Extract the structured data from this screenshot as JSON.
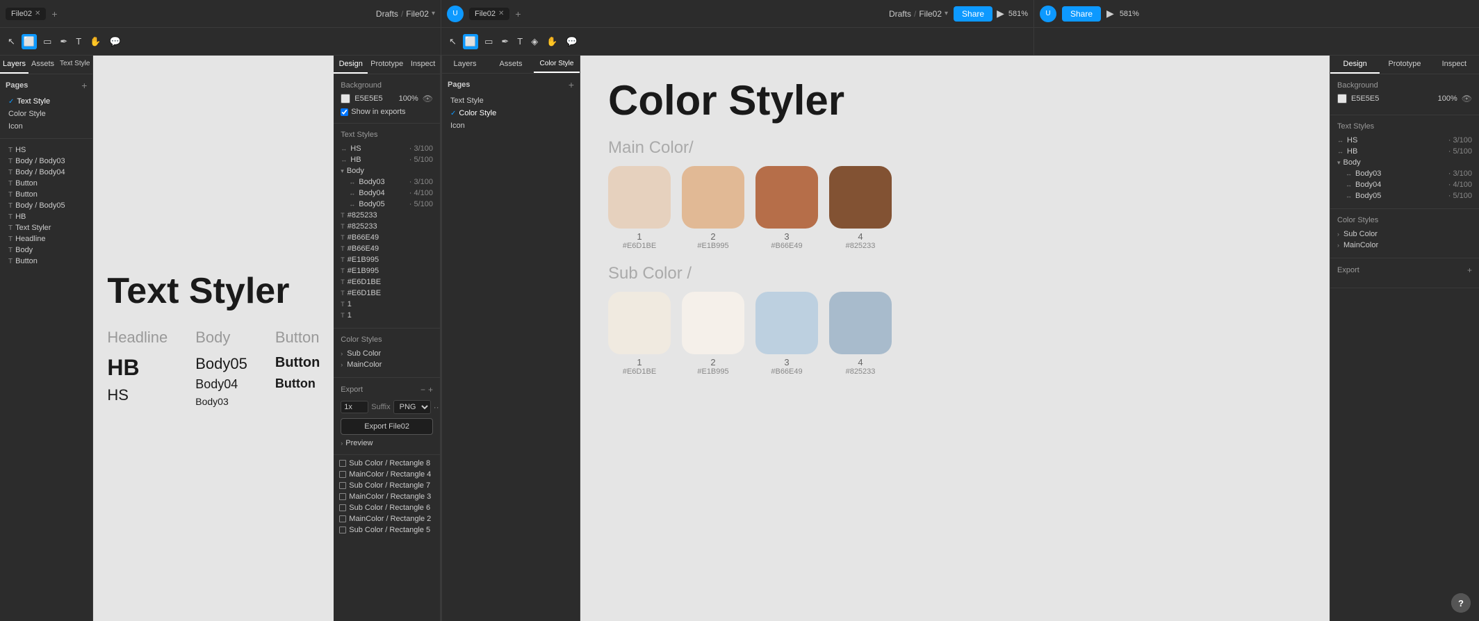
{
  "windows": {
    "left": {
      "title_bar": {
        "tab_label": "File02",
        "breadcrumb_drafts": "Drafts",
        "breadcrumb_sep": "/",
        "breadcrumb_file": "File02"
      },
      "toolbar": {},
      "left_panel": {
        "tabs": [
          "Layers",
          "Assets"
        ],
        "text_style_tab": "Text Style",
        "pages_label": "Pages",
        "pages": [
          {
            "label": "Text Style",
            "active": true
          },
          {
            "label": "Color Style",
            "active": false
          },
          {
            "label": "Icon",
            "active": false
          }
        ],
        "layers": [
          {
            "icon": "T",
            "label": "HS"
          },
          {
            "icon": "T",
            "label": "Body / Body03"
          },
          {
            "icon": "T",
            "label": "Body / Body04"
          },
          {
            "icon": "T",
            "label": "Button"
          },
          {
            "icon": "T",
            "label": "Button"
          },
          {
            "icon": "T",
            "label": "Body / Body05"
          },
          {
            "icon": "T",
            "label": "HB"
          },
          {
            "icon": "T",
            "label": "Text Styler"
          },
          {
            "icon": "T",
            "label": "Headline"
          },
          {
            "icon": "T",
            "label": "Body"
          },
          {
            "icon": "T",
            "label": "Button"
          }
        ]
      },
      "canvas": {
        "title": "Text Styler",
        "columns": [
          "Headline",
          "Body",
          "Button"
        ],
        "rows": [
          {
            "col1": "HB",
            "col2": "Body05",
            "col3": "Button"
          },
          {
            "col1": "HS",
            "col2": "Body04",
            "col3": "Button"
          },
          {
            "col1": "",
            "col2": "Body03",
            "col3": ""
          }
        ]
      },
      "design_panel": {
        "tabs": [
          "Design",
          "Prototype",
          "Inspect"
        ],
        "background_label": "Background",
        "bg_color": "E5E5E5",
        "bg_opacity": "100%",
        "show_in_exports": "Show in exports",
        "text_styles_label": "Text Styles",
        "text_styles": [
          {
            "label": "HS",
            "value": "3/100"
          },
          {
            "label": "HB",
            "value": "5/100"
          },
          {
            "group": "Body",
            "children": [
              {
                "label": "Body03",
                "value": "3/100"
              },
              {
                "label": "Body04",
                "value": "4/100"
              },
              {
                "label": "Body05",
                "value": "5/100"
              }
            ]
          },
          {
            "label": "#825233",
            "value": ""
          },
          {
            "label": "#825233",
            "value": ""
          },
          {
            "label": "#B66E49",
            "value": ""
          },
          {
            "label": "#B66E49",
            "value": ""
          },
          {
            "label": "#E1B995",
            "value": ""
          },
          {
            "label": "#E1B995",
            "value": ""
          },
          {
            "label": "#E6D1BE",
            "value": ""
          },
          {
            "label": "#E6D1BE",
            "value": ""
          },
          {
            "label": "1",
            "value": ""
          },
          {
            "label": "1",
            "value": ""
          }
        ],
        "color_styles_label": "Color Styles",
        "color_styles": [
          {
            "label": "Sub Color"
          },
          {
            "label": "MainColor"
          }
        ],
        "export_label": "Export",
        "export_scale": "1x",
        "export_suffix": "Suffix",
        "export_format": "PNG",
        "export_btn": "Export File02",
        "preview_label": "Preview",
        "layers_list": [
          {
            "label": "Sub Color / Rectangle 8"
          },
          {
            "label": "MainColor / Rectangle 4"
          },
          {
            "label": "Sub Color / Rectangle 7"
          },
          {
            "label": "MainColor / Rectangle 3"
          },
          {
            "label": "Sub Color / Rectangle 6"
          },
          {
            "label": "MainColor / Rectangle 2"
          },
          {
            "label": "Sub Color / Rectangle 5"
          }
        ]
      }
    },
    "right": {
      "title_bar": {
        "tab_label": "File02",
        "breadcrumb_drafts": "Drafts",
        "breadcrumb_sep": "/",
        "breadcrumb_file": "File02",
        "zoom": "581%",
        "share_btn": "Share"
      },
      "layers_panel": {
        "tabs": [
          "Layers",
          "Assets"
        ],
        "color_style_tab": "Color Style",
        "pages_label": "Pages",
        "pages": [
          {
            "label": "Text Style",
            "active": false
          },
          {
            "label": "Color Style",
            "active": true
          },
          {
            "label": "Icon",
            "active": false
          }
        ]
      },
      "canvas": {
        "title": "Color Styler",
        "main_color_label": "Main Color/",
        "sub_color_label": "Sub Color /",
        "main_swatches": [
          {
            "num": "1",
            "hex": "#E6D1BE",
            "color": "#E6D1BE"
          },
          {
            "num": "2",
            "hex": "#E1B995",
            "color": "#E1B995"
          },
          {
            "num": "3",
            "hex": "#B66E49",
            "color": "#B66E49"
          },
          {
            "num": "4",
            "hex": "#825233",
            "color": "#825233"
          }
        ],
        "sub_swatches": [
          {
            "num": "1",
            "hex": "#E6D1BE",
            "color": "#E8E0D8"
          },
          {
            "num": "2",
            "hex": "#E1B995",
            "color": "#F0EBE5"
          },
          {
            "num": "3",
            "hex": "#B66E49",
            "color": "#C8D8E8"
          },
          {
            "num": "4",
            "hex": "#825233",
            "color": "#A8B8CC"
          }
        ]
      },
      "design_panel": {
        "tabs": [
          "Design",
          "Prototype",
          "Inspect"
        ],
        "background_label": "Background",
        "bg_color": "E5E5E5",
        "bg_opacity": "100%",
        "text_styles_label": "Text Styles",
        "text_styles": [
          {
            "label": "HS",
            "value": "3/100"
          },
          {
            "label": "HB",
            "value": "5/100"
          },
          {
            "group": "Body",
            "children": [
              {
                "label": "Body03",
                "value": "3/100"
              },
              {
                "label": "Body04",
                "value": "4/100"
              },
              {
                "label": "Body05",
                "value": "5/100"
              }
            ]
          }
        ],
        "color_styles_label": "Color Styles",
        "color_styles": [
          {
            "label": "Sub Color"
          },
          {
            "label": "MainColor"
          }
        ],
        "export_label": "Export",
        "sub_color_label": "Sub Color",
        "main_color_style_label": "MainColor"
      }
    }
  }
}
